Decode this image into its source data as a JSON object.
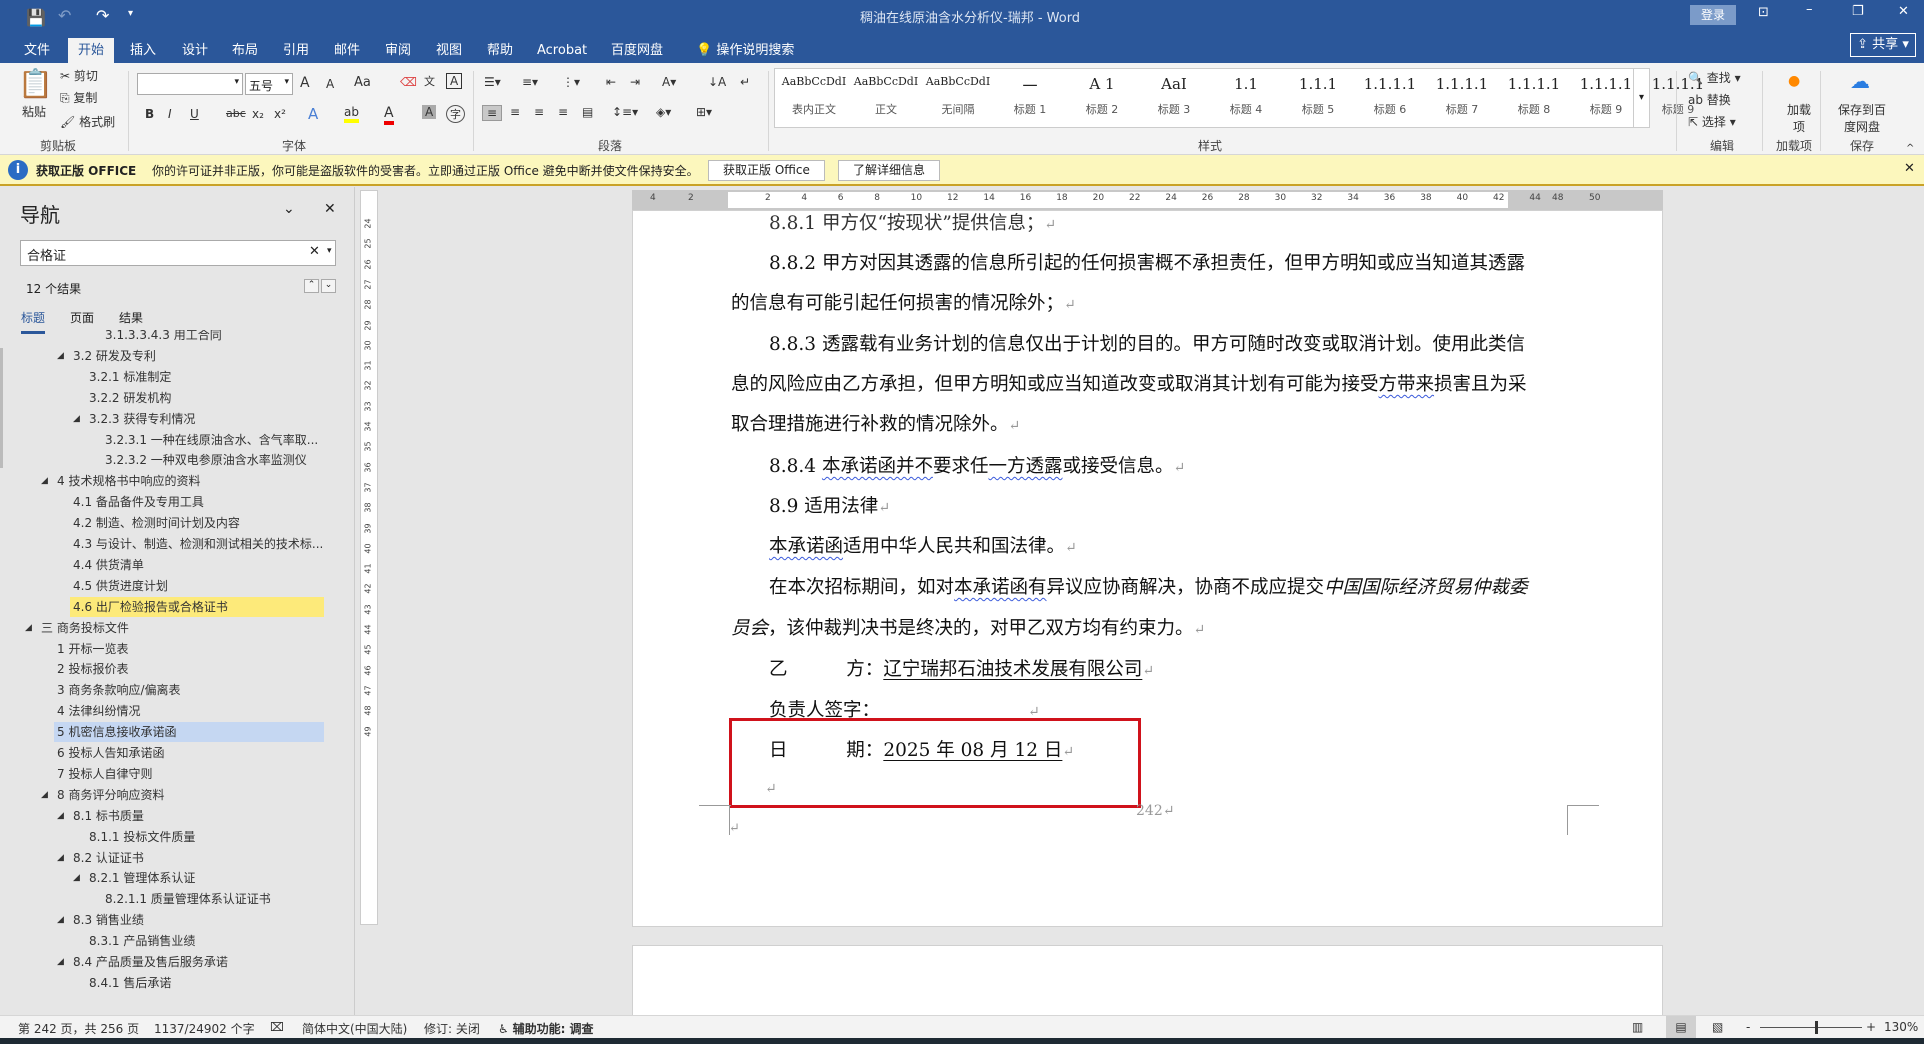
{
  "title": {
    "doc": "稠油在线原油含水分析仪-瑞邦 - Word",
    "login": "登录",
    "share": "共享"
  },
  "tabs": [
    "文件",
    "开始",
    "插入",
    "设计",
    "布局",
    "引用",
    "邮件",
    "审阅",
    "视图",
    "帮助",
    "Acrobat",
    "百度网盘",
    "操作说明搜索"
  ],
  "ribbon": {
    "clipboard": {
      "paste": "粘贴",
      "cut": "剪切",
      "copy": "复制",
      "format_painter": "格式刷",
      "label": "剪贴板"
    },
    "font": {
      "font_name": "",
      "font_size": "五号",
      "label": "字体",
      "grow": "A",
      "shrink": "A",
      "case": "Aa",
      "bold": "B",
      "italic": "I",
      "underline": "U",
      "strike": "abc",
      "sub": "x₂",
      "sup": "x²"
    },
    "paragraph": {
      "label": "段落"
    },
    "styles": {
      "label": "样式",
      "items": [
        {
          "preview": "AaBbCcDdI",
          "name": "表内正文"
        },
        {
          "preview": "AaBbCcDdI",
          "name": "正文"
        },
        {
          "preview": "AaBbCcDdI",
          "name": "无间隔"
        },
        {
          "preview": "一",
          "name": "标题 1"
        },
        {
          "preview": "A 1",
          "name": "标题 2"
        },
        {
          "preview": "AaI",
          "name": "标题 3"
        },
        {
          "preview": "1.1",
          "name": "标题 4"
        },
        {
          "preview": "1.1.1",
          "name": "标题 5"
        },
        {
          "preview": "1.1.1.1",
          "name": "标题 6"
        },
        {
          "preview": "1.1.1.1",
          "name": "标题 7"
        },
        {
          "preview": "1.1.1.1",
          "name": "标题 8"
        },
        {
          "preview": "1.1.1.1",
          "name": "标题 9"
        },
        {
          "preview": "1.1.1.1",
          "name": "标题 9"
        }
      ]
    },
    "editing": {
      "find": "查找",
      "replace": "替换",
      "select": "选择",
      "label": "编辑"
    },
    "addins": {
      "btn": "加载项",
      "label": "加载项"
    },
    "save": {
      "btn": "保存到百度网盘",
      "label": "保存"
    }
  },
  "warning": {
    "title": "获取正版 OFFICE",
    "message": "你的许可证并非正版，你可能是盗版软件的受害者。立即通过正版 Office 避免中断并使文件保持安全。",
    "btn_get": "获取正版 Office",
    "btn_info": "了解详细信息"
  },
  "nav": {
    "title": "导航",
    "search": "合格证",
    "results": "12 个结果",
    "tabs": [
      "标题",
      "页面",
      "结果"
    ],
    "items": [
      {
        "t": "3.1.3.3.4.3 用工合同",
        "l": 4,
        "tri": false,
        "partial": true
      },
      {
        "t": "3.2 研发及专利",
        "l": 2,
        "tri": true
      },
      {
        "t": "3.2.1 标准制定",
        "l": 3,
        "tri": false
      },
      {
        "t": "3.2.2 研发机构",
        "l": 3,
        "tri": false
      },
      {
        "t": "3.2.3 获得专利情况",
        "l": 3,
        "tri": true
      },
      {
        "t": "3.2.3.1 一种在线原油含水、含气率取...",
        "l": 4,
        "tri": false
      },
      {
        "t": "3.2.3.2 一种双电参原油含水率监测仪",
        "l": 4,
        "tri": false
      },
      {
        "t": "4 技术规格书中响应的资料",
        "l": 1,
        "tri": true
      },
      {
        "t": "4.1 备品备件及专用工具",
        "l": 2,
        "tri": false
      },
      {
        "t": "4.2 制造、检测时间计划及内容",
        "l": 2,
        "tri": false
      },
      {
        "t": "4.3 与设计、制造、检测和测试相关的技术标...",
        "l": 2,
        "tri": false
      },
      {
        "t": "4.4 供货清单",
        "l": 2,
        "tri": false
      },
      {
        "t": "4.5 供货进度计划",
        "l": 2,
        "tri": false
      },
      {
        "t": "4.6 出厂检验报告或合格证书",
        "l": 2,
        "tri": false,
        "hl": "match"
      },
      {
        "t": "三 商务投标文件",
        "l": 0,
        "tri": true
      },
      {
        "t": "1 开标一览表",
        "l": 1,
        "tri": false
      },
      {
        "t": "2 投标报价表",
        "l": 1,
        "tri": false
      },
      {
        "t": "3 商务条款响应/偏离表",
        "l": 1,
        "tri": false
      },
      {
        "t": "4 法律纠纷情况",
        "l": 1,
        "tri": false
      },
      {
        "t": "5 机密信息接收承诺函",
        "l": 1,
        "tri": false,
        "hl": "current"
      },
      {
        "t": "6 投标人告知承诺函",
        "l": 1,
        "tri": false
      },
      {
        "t": "7 投标人自律守则",
        "l": 1,
        "tri": false
      },
      {
        "t": "8 商务评分响应资料",
        "l": 1,
        "tri": true
      },
      {
        "t": "8.1 标书质量",
        "l": 2,
        "tri": true
      },
      {
        "t": "8.1.1 投标文件质量",
        "l": 3,
        "tri": false
      },
      {
        "t": "8.2 认证证书",
        "l": 2,
        "tri": true
      },
      {
        "t": "8.2.1 管理体系认证",
        "l": 3,
        "tri": true
      },
      {
        "t": "8.2.1.1 质量管理体系认证证书",
        "l": 4,
        "tri": false
      },
      {
        "t": "8.3 销售业绩",
        "l": 2,
        "tri": true
      },
      {
        "t": "8.3.1 产品销售业绩",
        "l": 3,
        "tri": false
      },
      {
        "t": "8.4 产品质量及售后服务承诺",
        "l": 2,
        "tri": true
      },
      {
        "t": "8.4.1 售后承诺",
        "l": 3,
        "tri": false
      }
    ]
  },
  "hruler": [
    "4",
    "2",
    "2",
    "4",
    "6",
    "8",
    "10",
    "12",
    "14",
    "16",
    "18",
    "20",
    "22",
    "24",
    "26",
    "28",
    "30",
    "32",
    "34",
    "36",
    "38",
    "40",
    "42",
    "44",
    "48",
    "50"
  ],
  "vruler": [
    "24",
    "25",
    "26",
    "27",
    "28",
    "29",
    "30",
    "31",
    "32",
    "33",
    "34",
    "35",
    "36",
    "37",
    "38",
    "39",
    "40",
    "41",
    "42",
    "43",
    "44",
    "45",
    "46",
    "47",
    "48",
    "49"
  ],
  "doc": {
    "l1": "8.8.1 甲方仅“按现状”提供信息；",
    "l2": "8.8.2 甲方对因其透露的信息所引起的任何损害概不承担责任，但甲方明知或应当知道其透露",
    "l3": "的信息有可能引起任何损害的情况除外；",
    "l4": "8.8.3 透露载有业务计划的信息仅出于计划的目的。甲方可随时改变或取消计划。使用此类信",
    "l5a": "息的风险应由乙方承担，但甲方明知或应当知道改变或取消其计划有可能为接受",
    "l5b": "方带来",
    "l5c": "损害且为采",
    "l6": "取合理措施进行补救的情况除外。",
    "l7a": "8.8.4 ",
    "l7b": "本承诺函并不",
    "l7c": "要求任",
    "l7d": "一方透露",
    "l7e": "或接受信息。",
    "l8": "8.9 适用法律",
    "l9a": "本承诺函",
    "l9b": "适用中华人民共和国法律。",
    "l10a": "在本次招标期间，如对",
    "l10b": "本承诺函有",
    "l10c": "异议应协商解决，协商不成应提交",
    "l10d": "中国国际经济贸易仲裁委",
    "l11a": "员会",
    "l11b": "，该仲裁判决书是终决的，对甲乙双方均有约束力。",
    "party_label": "乙          方：",
    "party": "辽宁瑞邦石油技术发展有限公司",
    "sign_label": "负责人签字：",
    "sign": "________________",
    "date_label": "日          期：",
    "date": "2025 年 08 月 12 日",
    "page_num": "242",
    "pilcrow": "↵"
  },
  "status": {
    "page": "第 242 页，共 256 页",
    "words": "1137/24902 个字",
    "lang": "简体中文(中国大陆)",
    "track": "修订: 关闭",
    "access": "辅助功能: 调查",
    "zoom": "130%",
    "zoom_level": 130
  },
  "colors": {
    "brand": "#2b579a",
    "warn": "#fcf7bd",
    "match": "#fdea7a",
    "current": "#c5d7f2",
    "redbox": "#d0121b"
  }
}
